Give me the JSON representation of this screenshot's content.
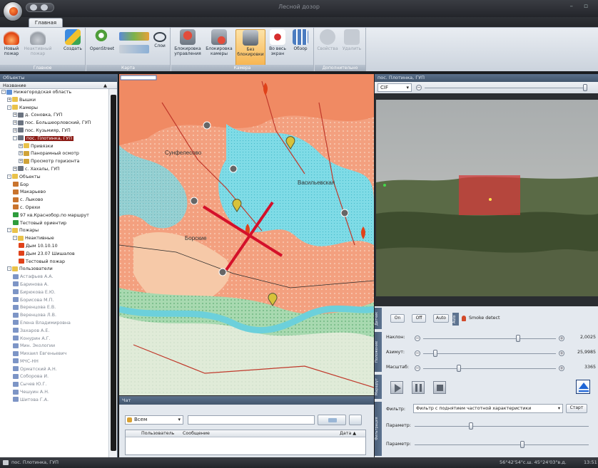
{
  "window": {
    "title": "Лесной дозор",
    "controls": "– ▫"
  },
  "tabs": [
    {
      "label": "Главная"
    }
  ],
  "ribbon": {
    "groups": [
      {
        "label": "Главное",
        "buttons": [
          {
            "label": "Новый пожар",
            "icon": "fire-icon"
          },
          {
            "label": "Неактивный пожар",
            "icon": "fire-inactive-icon",
            "disabled": true
          },
          {
            "label": "Создать",
            "icon": "create-icon"
          }
        ]
      },
      {
        "label": "Карта",
        "buttons": [
          {
            "label": "OpenStreet",
            "icon": "map-search-icon"
          },
          {
            "label": "Слои",
            "icon": "layers-icon"
          }
        ]
      },
      {
        "label": "Камера",
        "buttons": [
          {
            "label": "Блокировка управления",
            "icon": "lock-control-icon"
          },
          {
            "label": "Блокировка камеры",
            "icon": "lock-camera-icon"
          },
          {
            "label": "Без блокировки",
            "icon": "camera-icon",
            "active": true
          },
          {
            "label": "Во весь экран",
            "icon": "fullscreen-icon"
          },
          {
            "label": "Обзор",
            "icon": "overview-icon"
          }
        ]
      },
      {
        "label": "Дополнительно",
        "buttons": [
          {
            "label": "Свойства",
            "icon": "properties-icon",
            "disabled": true
          },
          {
            "label": "Удалить",
            "icon": "delete-icon",
            "disabled": true
          }
        ]
      }
    ]
  },
  "objects_panel": {
    "title": "Объекты",
    "column": "Название",
    "tree": [
      {
        "label": "Нижегородская область",
        "lvl": 0,
        "icon": "region-icon",
        "ex": "-"
      },
      {
        "label": "Вышки",
        "lvl": 1,
        "icon": "folder-icon",
        "ex": "+"
      },
      {
        "label": "Камеры",
        "lvl": 1,
        "icon": "folder-icon",
        "ex": "-"
      },
      {
        "label": "д. Соновка, ГУП",
        "lvl": 2,
        "icon": "camera-icon",
        "ex": "+"
      },
      {
        "label": "пос. Большеорловский, ГУП",
        "lvl": 2,
        "icon": "camera-icon",
        "ex": "+"
      },
      {
        "label": "пос. Кузьмияр, ГУП",
        "lvl": 2,
        "icon": "camera-icon",
        "ex": "+"
      },
      {
        "label": "пос. Плотинка, ГУП",
        "lvl": 2,
        "icon": "camera-icon",
        "ex": "-",
        "selected": true
      },
      {
        "label": "Привязки",
        "lvl": 3,
        "icon": "folder-icon",
        "ex": "+"
      },
      {
        "label": "Панорамный осмотр",
        "lvl": 3,
        "icon": "panorama-icon",
        "ex": "+"
      },
      {
        "label": "Просмотр горизонта",
        "lvl": 3,
        "icon": "horizon-icon",
        "ex": "+"
      },
      {
        "label": "с. Хахалы, ГУП",
        "lvl": 2,
        "icon": "camera-icon",
        "ex": "+"
      },
      {
        "label": "Объекты",
        "lvl": 1,
        "icon": "folder-icon",
        "ex": "-"
      },
      {
        "label": "Бор",
        "lvl": 2,
        "icon": "house-icon"
      },
      {
        "label": "Макарьево",
        "lvl": 2,
        "icon": "house-icon"
      },
      {
        "label": "с. Лыково",
        "lvl": 2,
        "icon": "house-icon"
      },
      {
        "label": "с. Орехи",
        "lvl": 2,
        "icon": "house-icon"
      },
      {
        "label": "97 кв.Краснобор.по маршрут",
        "lvl": 2,
        "icon": "flag-icon"
      },
      {
        "label": "Тестовый ориентир",
        "lvl": 2,
        "icon": "flag-icon"
      },
      {
        "label": "Пожары",
        "lvl": 1,
        "icon": "folder-icon",
        "ex": "-"
      },
      {
        "label": "Неактивные",
        "lvl": 2,
        "icon": "folder-icon",
        "ex": "-"
      },
      {
        "label": "Дым 10.10.10",
        "lvl": 3,
        "icon": "fire-icon"
      },
      {
        "label": "Дым 23.07 Шишалов",
        "lvl": 3,
        "icon": "fire-icon"
      },
      {
        "label": "Тестовый пожар",
        "lvl": 3,
        "icon": "fire-icon"
      },
      {
        "label": "Пользователи",
        "lvl": 1,
        "icon": "folder-icon",
        "ex": "-"
      },
      {
        "label": "Астафьев А.А.",
        "lvl": 2,
        "icon": "user-icon",
        "gray": true
      },
      {
        "label": "Баринова А.",
        "lvl": 2,
        "icon": "user-icon",
        "gray": true
      },
      {
        "label": "Бирюкова Е.Ю.",
        "lvl": 2,
        "icon": "user-icon",
        "gray": true
      },
      {
        "label": "Борисова М.П.",
        "lvl": 2,
        "icon": "user-icon",
        "gray": true
      },
      {
        "label": "Веренцова Е.В.",
        "lvl": 2,
        "icon": "user-icon",
        "gray": true
      },
      {
        "label": "Веренцова Л.В.",
        "lvl": 2,
        "icon": "user-icon",
        "gray": true
      },
      {
        "label": "Елена Владимировна",
        "lvl": 2,
        "icon": "user-icon",
        "gray": true
      },
      {
        "label": "Захаров А.Е.",
        "lvl": 2,
        "icon": "user-icon",
        "gray": true
      },
      {
        "label": "Конурин А.Г.",
        "lvl": 2,
        "icon": "user-icon",
        "gray": true
      },
      {
        "label": "Мин. Экологии",
        "lvl": 2,
        "icon": "user-icon",
        "gray": true
      },
      {
        "label": "Михаил Евгеньевич",
        "lvl": 2,
        "icon": "user-icon",
        "gray": true
      },
      {
        "label": "МЧС-НН",
        "lvl": 2,
        "icon": "user-icon",
        "gray": true
      },
      {
        "label": "Орматский А.Н.",
        "lvl": 2,
        "icon": "user-icon",
        "gray": true
      },
      {
        "label": "Соборова И.",
        "lvl": 2,
        "icon": "user-icon",
        "gray": true
      },
      {
        "label": "Сычев Ю.Г.",
        "lvl": 2,
        "icon": "user-icon",
        "gray": true
      },
      {
        "label": "Чешуин А.Н.",
        "lvl": 2,
        "icon": "user-icon",
        "gray": true
      },
      {
        "label": "Шитова Г.А.",
        "lvl": 2,
        "icon": "user-icon",
        "gray": true
      }
    ]
  },
  "map": {
    "labels": [
      "Сунфелесово",
      "Васильевская",
      "Борские"
    ]
  },
  "chat": {
    "title": "Чат",
    "recipient": "Всем",
    "columns": [
      "Пользователь",
      "Сообщение",
      "Дата ▲"
    ]
  },
  "video": {
    "title": "пос. Плотинка, ГУП",
    "format": "CIF"
  },
  "controls": {
    "on": "On",
    "off": "Off",
    "auto": "Auto",
    "smoke_detect": "Smoke detect",
    "side_tabs": [
      "Датчик",
      "Положение",
      "Маршрут",
      "Фильтрация"
    ],
    "sliders": [
      {
        "label": "Наклон:",
        "value": "2,0025",
        "pos": 0.72
      },
      {
        "label": "Азимут:",
        "value": "25,9985",
        "pos": 0.08
      },
      {
        "label": "Масштаб:",
        "value": "3365",
        "pos": 0.26
      }
    ],
    "filter_label": "Фильтр:",
    "filter_value": "Фильтр с поднятием частотной характеристики",
    "start": "Старт",
    "param1": "Параметр:",
    "param1_pos": 0.32,
    "param2": "Параметр:",
    "param2_pos": 0.62
  },
  "status": {
    "left": "пос. Плотинка, ГУП",
    "coords": "56°42'54\"с.ш. 45°24'03\"в.д.",
    "time": "13:51"
  }
}
